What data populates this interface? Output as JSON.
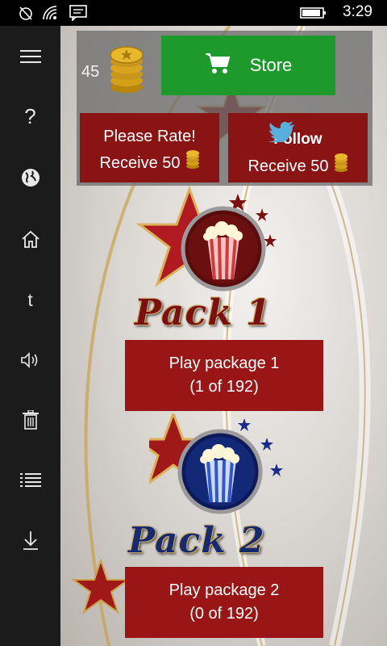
{
  "status_bar": {
    "time": "3:29",
    "icons": [
      "notification-off-icon",
      "wifi-signal-icon",
      "message-icon",
      "battery-icon"
    ]
  },
  "sidebar": {
    "items": [
      {
        "name": "menu",
        "icon": "hamburger-icon"
      },
      {
        "name": "help",
        "icon": "question-icon",
        "glyph": "?"
      },
      {
        "name": "web",
        "icon": "globe-icon"
      },
      {
        "name": "home",
        "icon": "home-icon"
      },
      {
        "name": "tumblr",
        "icon": "tumblr-icon",
        "glyph": "t"
      },
      {
        "name": "sound",
        "icon": "speaker-icon"
      },
      {
        "name": "delete",
        "icon": "trash-icon"
      },
      {
        "name": "list",
        "icon": "list-icon"
      },
      {
        "name": "download",
        "icon": "download-icon"
      }
    ]
  },
  "header": {
    "coins": "45",
    "store_label": "Store",
    "rate": {
      "line1": "Please Rate!",
      "line2": "Receive 50"
    },
    "follow": {
      "line1": "Follow",
      "line2": "Receive 50"
    }
  },
  "packs": [
    {
      "title": "Pack 1",
      "button_line1": "Play package 1",
      "button_line2": "(1 of 192)",
      "color": "#c8181e"
    },
    {
      "title": "Pack 2",
      "button_line1": "Play package 2",
      "button_line2": "(0 of 192)",
      "color": "#1f3fa8"
    }
  ],
  "colors": {
    "store_green": "#1e9a2d",
    "promo_red": "#8a1414",
    "play_red": "#9a1616",
    "sidebar_bg": "#1b1b1b"
  }
}
